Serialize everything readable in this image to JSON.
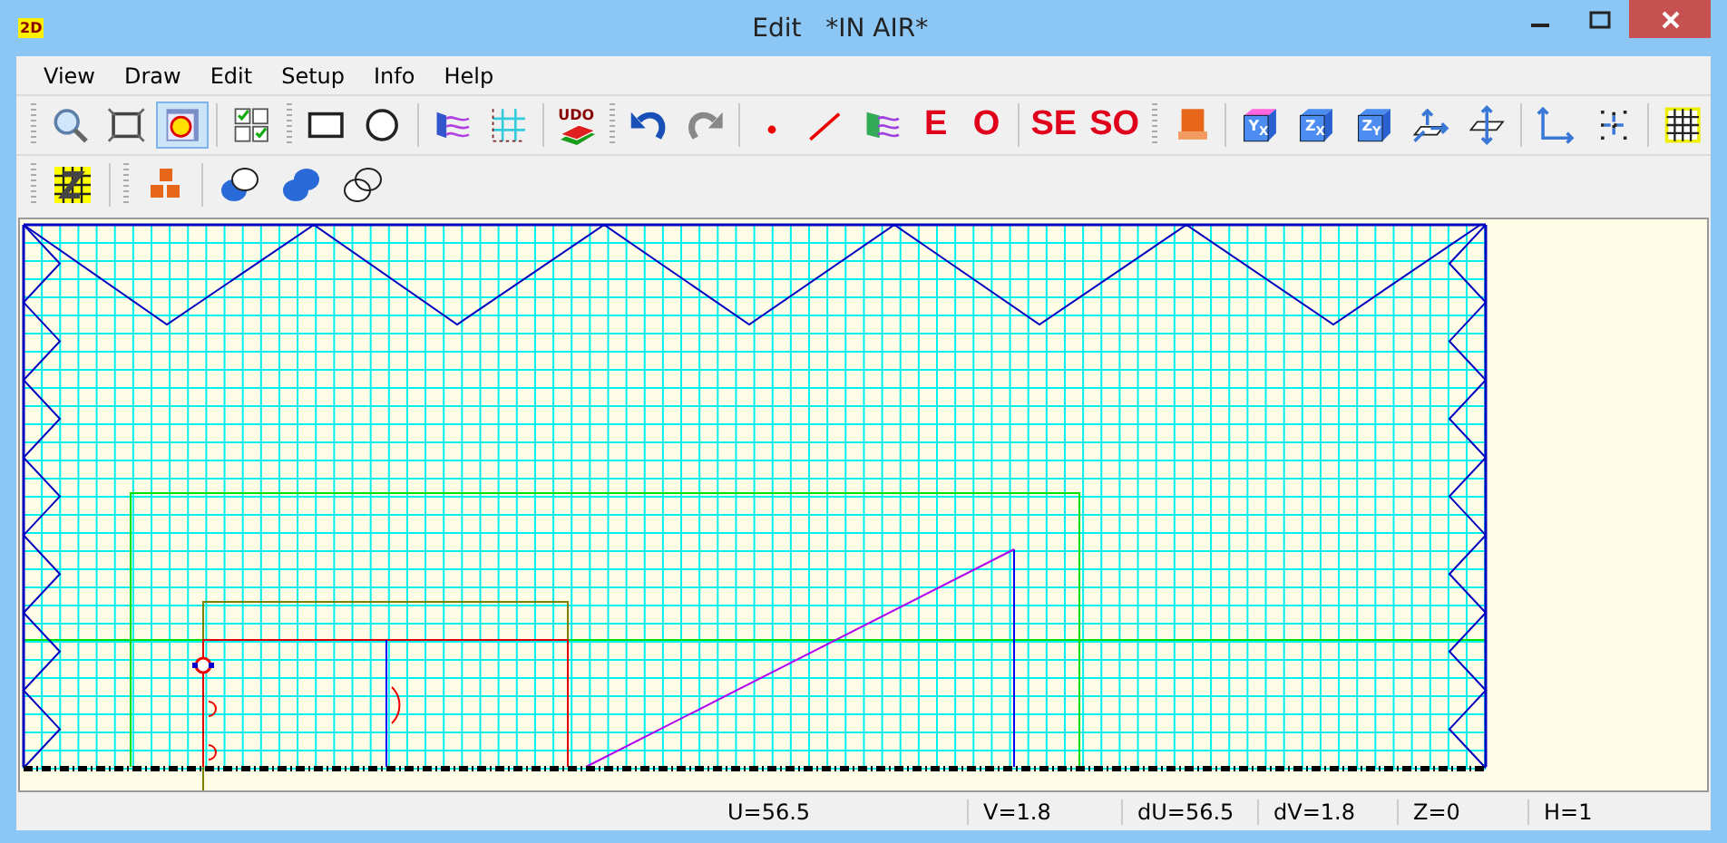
{
  "window": {
    "title": "Edit   *IN AIR*",
    "logo": "2D"
  },
  "menu": [
    {
      "label": "View"
    },
    {
      "label": "Draw"
    },
    {
      "label": "Edit"
    },
    {
      "label": "Setup"
    },
    {
      "label": "Info"
    },
    {
      "label": "Help"
    }
  ],
  "toolbars": [
    {
      "items": [
        {
          "kind": "grip"
        },
        {
          "kind": "icon",
          "selected": false
        },
        {
          "kind": "icon",
          "selected": false
        },
        {
          "kind": "icon",
          "selected": true
        },
        {
          "kind": "separator"
        },
        {
          "kind": "icon",
          "selected": false
        },
        {
          "kind": "grip"
        },
        {
          "kind": "icon",
          "selected": false
        },
        {
          "kind": "icon",
          "selected": false
        },
        {
          "kind": "separator"
        },
        {
          "kind": "icon",
          "selected": false
        },
        {
          "kind": "icon",
          "selected": false
        },
        {
          "kind": "separator"
        },
        {
          "kind": "books",
          "label": "UDO",
          "selected": false
        },
        {
          "kind": "grip"
        },
        {
          "kind": "icon",
          "selected": false
        },
        {
          "kind": "icon",
          "selected": false
        },
        {
          "kind": "separator"
        },
        {
          "kind": "icon",
          "selected": false
        },
        {
          "kind": "icon",
          "selected": false
        },
        {
          "kind": "icon",
          "selected": false
        },
        {
          "kind": "text",
          "label": "E",
          "selected": false
        },
        {
          "kind": "text",
          "label": "O",
          "selected": false
        },
        {
          "kind": "separator"
        },
        {
          "kind": "text",
          "label": "SE",
          "selected": false
        },
        {
          "kind": "text",
          "label": "SO",
          "selected": false
        },
        {
          "kind": "grip"
        },
        {
          "kind": "icon",
          "selected": false
        },
        {
          "kind": "separator"
        },
        {
          "kind": "cube",
          "label": "Y$_{X}$",
          "color": "#ff66dd",
          "selected": false
        },
        {
          "kind": "cube",
          "label": "Z$_{X}$",
          "color": "#4d8cf0",
          "selected": false
        },
        {
          "kind": "cube",
          "label": "Z$_{Y}$",
          "color": "#4d8cf0",
          "selected": false
        },
        {
          "kind": "icon",
          "selected": false
        },
        {
          "kind": "icon",
          "selected": false
        },
        {
          "kind": "separator"
        },
        {
          "kind": "icon",
          "selected": false
        },
        {
          "kind": "icon",
          "selected": false
        },
        {
          "kind": "separator"
        },
        {
          "kind": "icon",
          "selected": false
        }
      ]
    },
    {
      "items": [
        {
          "kind": "grip"
        },
        {
          "kind": "icon",
          "selected": false
        },
        {
          "kind": "separator"
        },
        {
          "kind": "grip"
        },
        {
          "kind": "icon",
          "selected": false
        },
        {
          "kind": "separator"
        },
        {
          "kind": "icon",
          "selected": false
        },
        {
          "kind": "icon",
          "selected": false
        },
        {
          "kind": "icon",
          "selected": false
        }
      ]
    }
  ],
  "status_bar": [
    {
      "text": "U=56.5"
    },
    {
      "text": "V=1.8"
    },
    {
      "text": "dU=56.5"
    },
    {
      "text": "dV=1.8"
    },
    {
      "text": "Z=0"
    },
    {
      "text": "H=1"
    }
  ]
}
